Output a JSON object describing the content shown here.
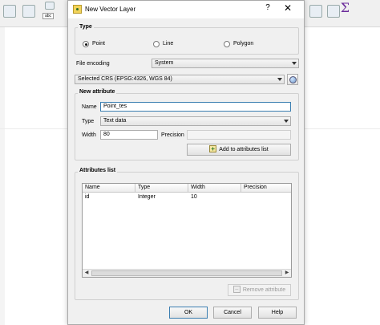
{
  "background": {
    "toolbar_icons": [
      "gear-icon",
      "pencil-icon",
      "undo-icon",
      "redo-icon",
      "layer-icon",
      "page-icon",
      "label-icon",
      "sigma-icon"
    ],
    "abc_label": "abc",
    "sigma": "Σ"
  },
  "dialog": {
    "title": "New Vector Layer",
    "help_glyph": "?",
    "close_glyph": "✕"
  },
  "type_group": {
    "title": "Type",
    "options": [
      {
        "label": "Point",
        "checked": true
      },
      {
        "label": "Line",
        "checked": false
      },
      {
        "label": "Polygon",
        "checked": false
      }
    ]
  },
  "file_encoding": {
    "label": "File encoding",
    "value": "System"
  },
  "crs": {
    "value": "Selected CRS (EPSG:4326, WGS 84)"
  },
  "new_attribute": {
    "title": "New attribute",
    "name_label": "Name",
    "name_value": "Point_tes",
    "type_label": "Type",
    "type_value": "Text data",
    "width_label": "Width",
    "width_value": "80",
    "precision_label": "Precision",
    "precision_value": "",
    "add_button": "Add to attributes list"
  },
  "attributes_list": {
    "title": "Attributes list",
    "columns": [
      "Name",
      "Type",
      "Width",
      "Precision"
    ],
    "rows": [
      [
        "id",
        "Integer",
        "10",
        ""
      ]
    ],
    "scroll_left": "◀",
    "scroll_right": "▶",
    "remove_button": "Remove attribute"
  },
  "buttons": {
    "ok": "OK",
    "cancel": "Cancel",
    "help": "Help"
  }
}
